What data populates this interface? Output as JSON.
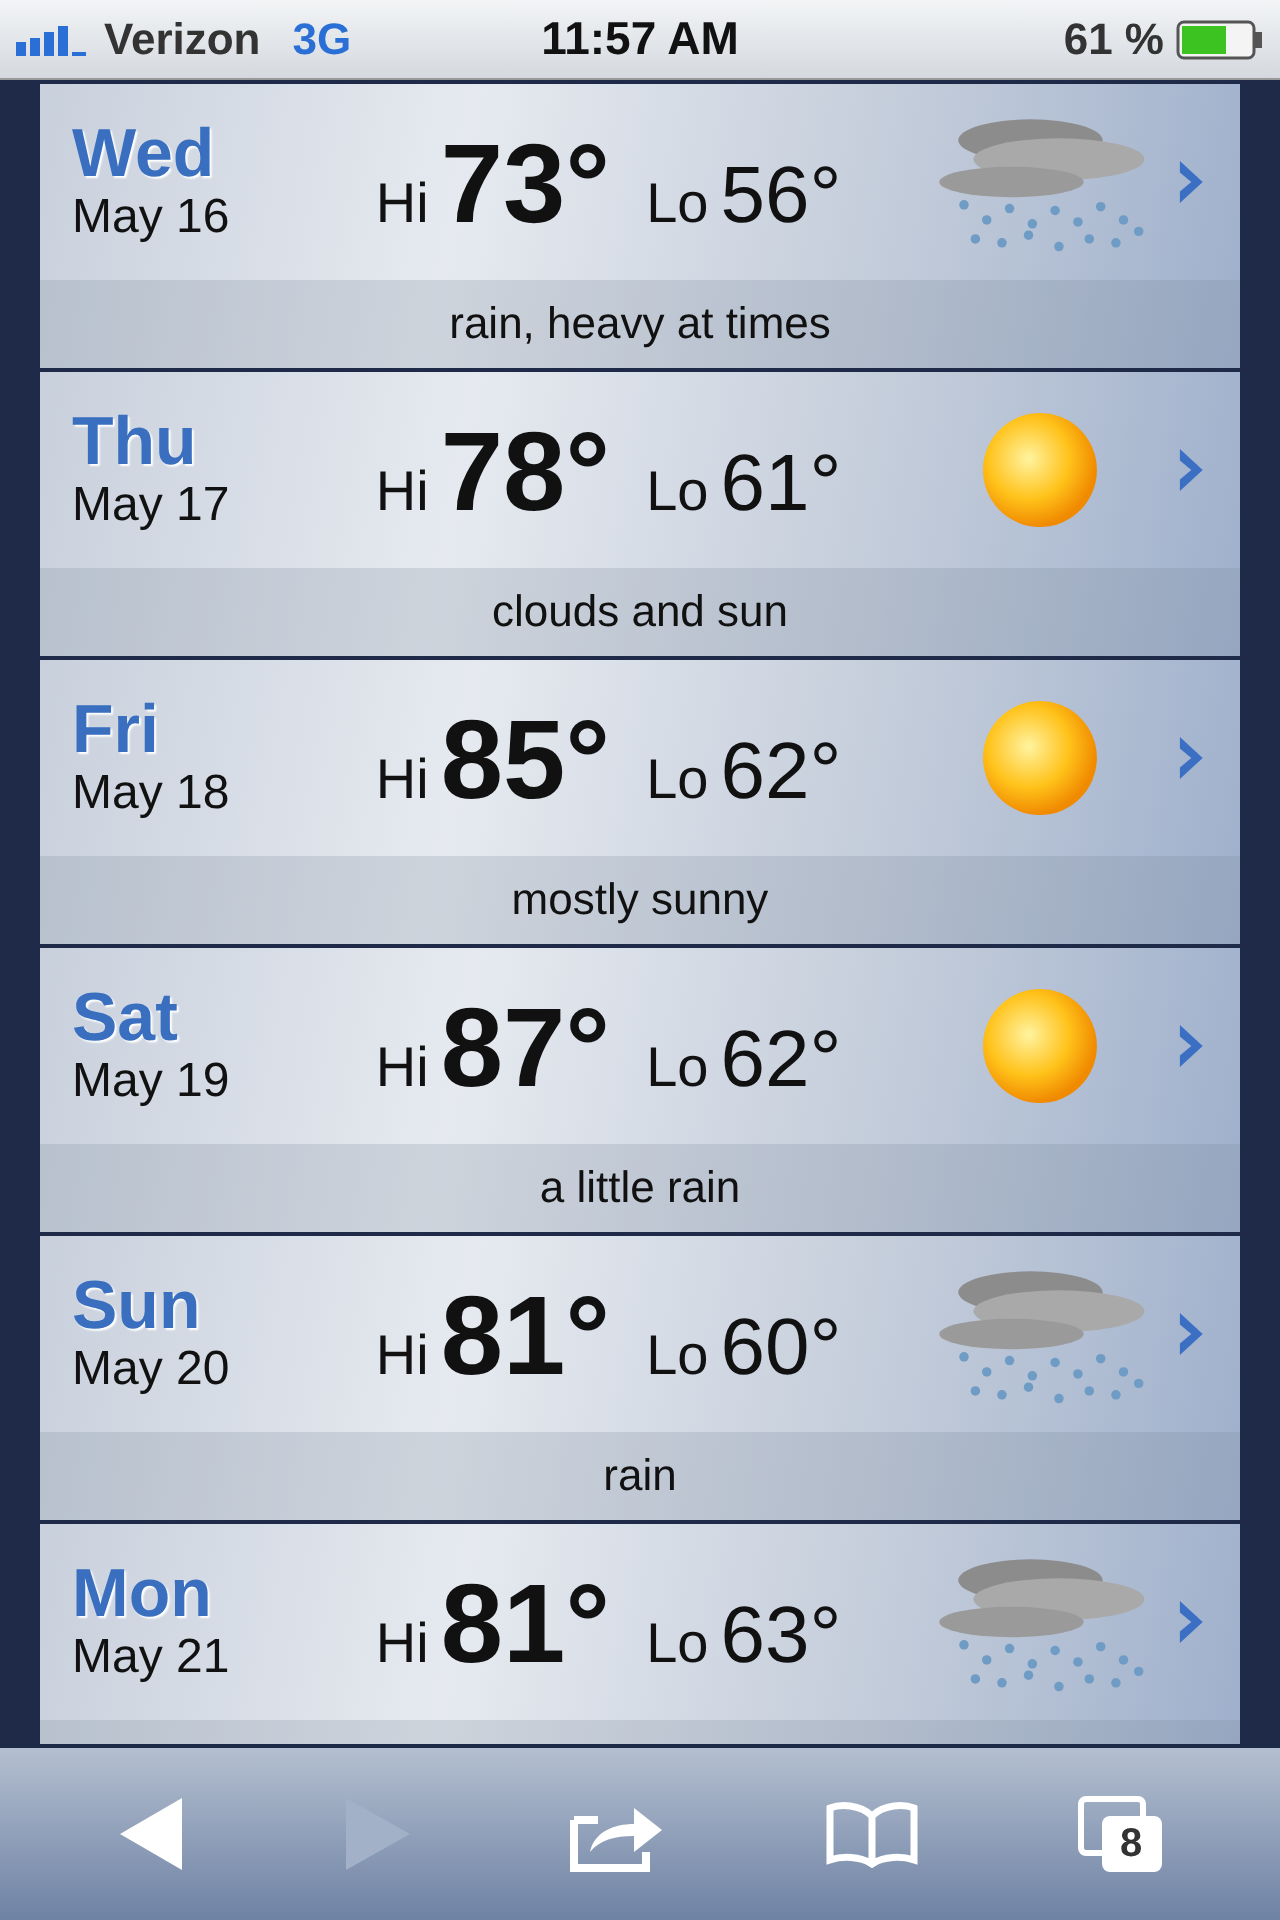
{
  "status_bar": {
    "carrier": "Verizon",
    "network": "3G",
    "time": "11:57 AM",
    "battery": "61 %"
  },
  "forecast": [
    {
      "day": "Wed",
      "date": "May 16",
      "hi_label": "Hi",
      "hi": "73°",
      "lo_label": "Lo",
      "lo": "56°",
      "kind": "rain",
      "condition": "rain, heavy at times"
    },
    {
      "day": "Thu",
      "date": "May 17",
      "hi_label": "Hi",
      "hi": "78°",
      "lo_label": "Lo",
      "lo": "61°",
      "kind": "sun",
      "condition": "clouds and sun"
    },
    {
      "day": "Fri",
      "date": "May 18",
      "hi_label": "Hi",
      "hi": "85°",
      "lo_label": "Lo",
      "lo": "62°",
      "kind": "sun",
      "condition": "mostly sunny"
    },
    {
      "day": "Sat",
      "date": "May 19",
      "hi_label": "Hi",
      "hi": "87°",
      "lo_label": "Lo",
      "lo": "62°",
      "kind": "sun",
      "condition": "a little rain"
    },
    {
      "day": "Sun",
      "date": "May 20",
      "hi_label": "Hi",
      "hi": "81°",
      "lo_label": "Lo",
      "lo": "60°",
      "kind": "rain",
      "condition": "rain"
    },
    {
      "day": "Mon",
      "date": "May 21",
      "hi_label": "Hi",
      "hi": "81°",
      "lo_label": "Lo",
      "lo": "63°",
      "kind": "rain"
    }
  ],
  "toolbar": {
    "back_disabled": false,
    "forward_disabled": true,
    "tab_count": "8"
  }
}
